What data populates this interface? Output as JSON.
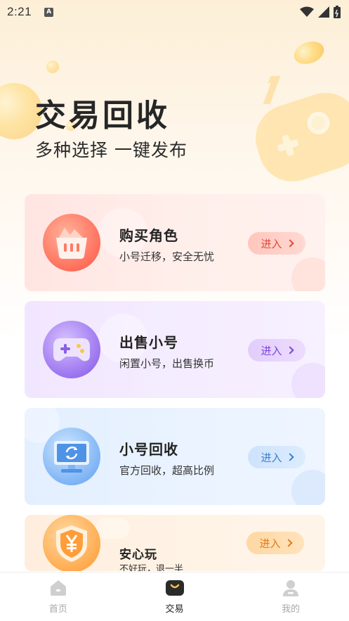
{
  "status_bar": {
    "time": "2:21",
    "notification_icon": "a-badge-icon",
    "icons": [
      "wifi-icon",
      "signal-icon",
      "battery-icon"
    ]
  },
  "hero": {
    "title": "交易回收",
    "subtitle": "多种选择 一键发布"
  },
  "cards": [
    {
      "id": "buy",
      "title": "购买角色",
      "desc": "小号迁移，安全无忧",
      "button": "进入",
      "icon": "basket-icon",
      "accent": "#e0483a"
    },
    {
      "id": "sell",
      "title": "出售小号",
      "desc": "闲置小号，出售换币",
      "button": "进入",
      "icon": "gamepad-icon",
      "accent": "#7a44d8"
    },
    {
      "id": "recycle",
      "title": "小号回收",
      "desc": "官方回收，超高比例",
      "button": "进入",
      "icon": "monitor-recycle-icon",
      "accent": "#3d7fcf"
    },
    {
      "id": "safe",
      "title": "安心玩",
      "desc": "不好玩，退一半",
      "button": "进入",
      "icon": "yuan-shield-icon",
      "accent": "#e07a1a"
    }
  ],
  "bottom_nav": [
    {
      "label": "首页",
      "icon": "home-icon",
      "active": false
    },
    {
      "label": "交易",
      "icon": "bag-icon",
      "active": true
    },
    {
      "label": "我的",
      "icon": "user-icon",
      "active": false
    }
  ]
}
